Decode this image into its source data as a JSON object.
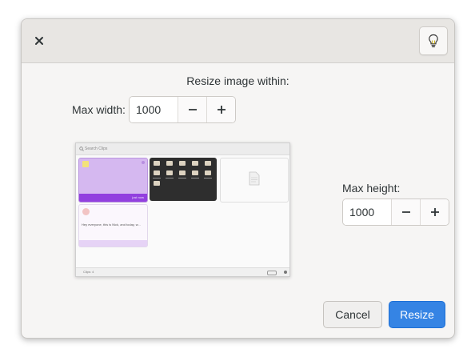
{
  "header": {
    "close_icon": "close-icon",
    "hint_icon": "lightbulb-icon"
  },
  "title": "Resize image within:",
  "max_width": {
    "label": "Max width:",
    "value": "1000",
    "minus_icon": "minus-icon",
    "plus_icon": "plus-icon"
  },
  "max_height": {
    "label": "Max height:",
    "value": "1000",
    "minus_icon": "minus-icon",
    "plus_icon": "plus-icon"
  },
  "preview": {
    "search_placeholder": "Search Clips",
    "card1_time": "just now",
    "card4_text": "Hey everyone, this is Nick, and today, w...",
    "footer_text": "Clips: 4"
  },
  "buttons": {
    "cancel": "Cancel",
    "resize": "Resize"
  },
  "colors": {
    "accent": "#3584e4",
    "preview_purple": "#9240df"
  }
}
